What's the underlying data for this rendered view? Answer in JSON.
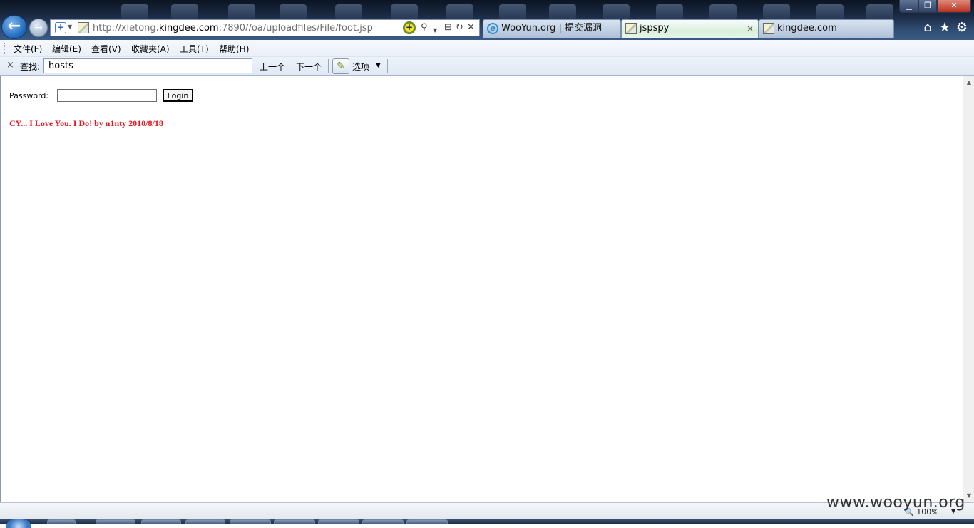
{
  "browser": {
    "address": {
      "url_prefix": "http://xietong.",
      "url_domain": "kingdee.com",
      "url_suffix": ":7890//oa/uploadfiles/File/foot.jsp"
    },
    "tabs": [
      {
        "label": "WooYun.org | 提交漏洞",
        "icon": "ie-icon"
      },
      {
        "label": "jspspy",
        "icon": "page-icon",
        "active": true,
        "close": "×"
      },
      {
        "label": "kingdee.com",
        "icon": "page-icon"
      }
    ]
  },
  "menu": {
    "items": [
      "文件(F)",
      "编辑(E)",
      "查看(V)",
      "收藏夹(A)",
      "工具(T)",
      "帮助(H)"
    ]
  },
  "findbar": {
    "close": "×",
    "label": "查找:",
    "query": "hosts",
    "prev": "上一个",
    "next": "下一个",
    "options": "选项"
  },
  "page": {
    "password_label": "Password:",
    "password_value": "",
    "login_button": "Login",
    "message": "CY... I Love You. I Do! by n1nty 2010/8/18",
    "message_color": "#e8141e"
  },
  "status": {
    "zoom": "100%"
  },
  "watermark": "www.wooyun.org"
}
